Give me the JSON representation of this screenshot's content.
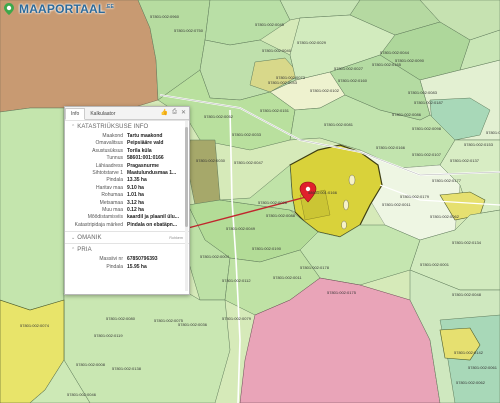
{
  "app": {
    "logo_text": "MAAPORTAAL",
    "logo_suffix": ".EE"
  },
  "colors": {
    "selected_parcel": "#d9d23a",
    "marker": "#e0202c",
    "connector": "#c0262d",
    "pink_area": "#e9a4b8",
    "brown_area": "#c89a72",
    "mint_area": "#a8d8b8"
  },
  "map_labels": [
    "57801:002:0960",
    "57801:002:0750",
    "57801:002:0045",
    "57801:002:0029",
    "57801:002:0040",
    "57801:002:0027",
    "57801:002:0165",
    "57801:002:0090",
    "57801:002:0043",
    "57801:002:0073",
    "57801:002:0102",
    "57801:002:0160",
    "57801:002:0044",
    "57801:002:0083",
    "57801:002:0187",
    "57801:002:0086",
    "57801:002:0081",
    "57801:002:0098",
    "57801:002:0166",
    "57801:002:0107",
    "57801:002:0177",
    "57801:002:0137",
    "57801:002:0153",
    "57801:002:0161",
    "57801:002:0151",
    "57801:002:0033",
    "57801:002:0052",
    "57801:002:0047",
    "57801:002:0030",
    "57801:002:0028",
    "57801:002:0049",
    "57801:002:0088",
    "57801:002:0190",
    "57801:002:0004",
    "57801:002:0112",
    "57801:002:0011",
    "57801:002:0178",
    "57801:002:0175",
    "57801:002:0079",
    "57801:002:0036",
    "57801:002:0075",
    "57801:002:0080",
    "57801:002:0074",
    "57801:002:0119",
    "57801:002:0008",
    "57801:002:0138",
    "57801:002:0046",
    "57801:002:0179",
    "57801:002:0011",
    "57801:002:0062",
    "57801:002:0134",
    "57801:002:0001",
    "57801:002:0048",
    "57801:002:0142",
    "57801:002:0062",
    "57801:002:0061",
    "58601:001:0166"
  ],
  "info_panel": {
    "tabs": [
      "Info",
      "Kalkulaator"
    ],
    "tool_icons": [
      "thumbs-up-icon",
      "print-icon",
      "close-icon"
    ],
    "sections": {
      "katastriyksus": {
        "title": "KATASTRIÜKSUSE INFO",
        "rows": [
          {
            "label": "Maakond",
            "value": "Tartu maakond"
          },
          {
            "label": "Omavalitsus",
            "value": "Peipsiääre vald"
          },
          {
            "label": "Asustusüksus",
            "value": "Torila küla"
          },
          {
            "label": "Tunnus",
            "value": "58601:001:0166"
          },
          {
            "label": "Lähiaadress",
            "value": "Pragasnurme"
          },
          {
            "label": "Sihtotstarve 1",
            "value": "Maatulundusmaa 1..."
          },
          {
            "label": "Pindala",
            "value": "13.35 ha"
          },
          {
            "label": "Haritav maa",
            "value": "9.10 ha"
          },
          {
            "label": "Rohumaa",
            "value": "1.01 ha"
          },
          {
            "label": "Metsamaa",
            "value": "3.12 ha"
          },
          {
            "label": "Muu maa",
            "value": "0.12 ha"
          },
          {
            "label": "Mõõdistamisviis",
            "value": "kaardil ja plaanil ülu..."
          },
          {
            "label": "Katastripidaja märked",
            "value": "Pindala on ebatäpn..."
          }
        ]
      },
      "omanik": {
        "title": "OMANIK",
        "more": "Rohkem"
      },
      "pria": {
        "title": "PRIA",
        "rows": [
          {
            "label": "Massiivi nr",
            "value": "67850796393"
          },
          {
            "label": "Pindala",
            "value": "15.95 ha"
          }
        ]
      }
    }
  }
}
